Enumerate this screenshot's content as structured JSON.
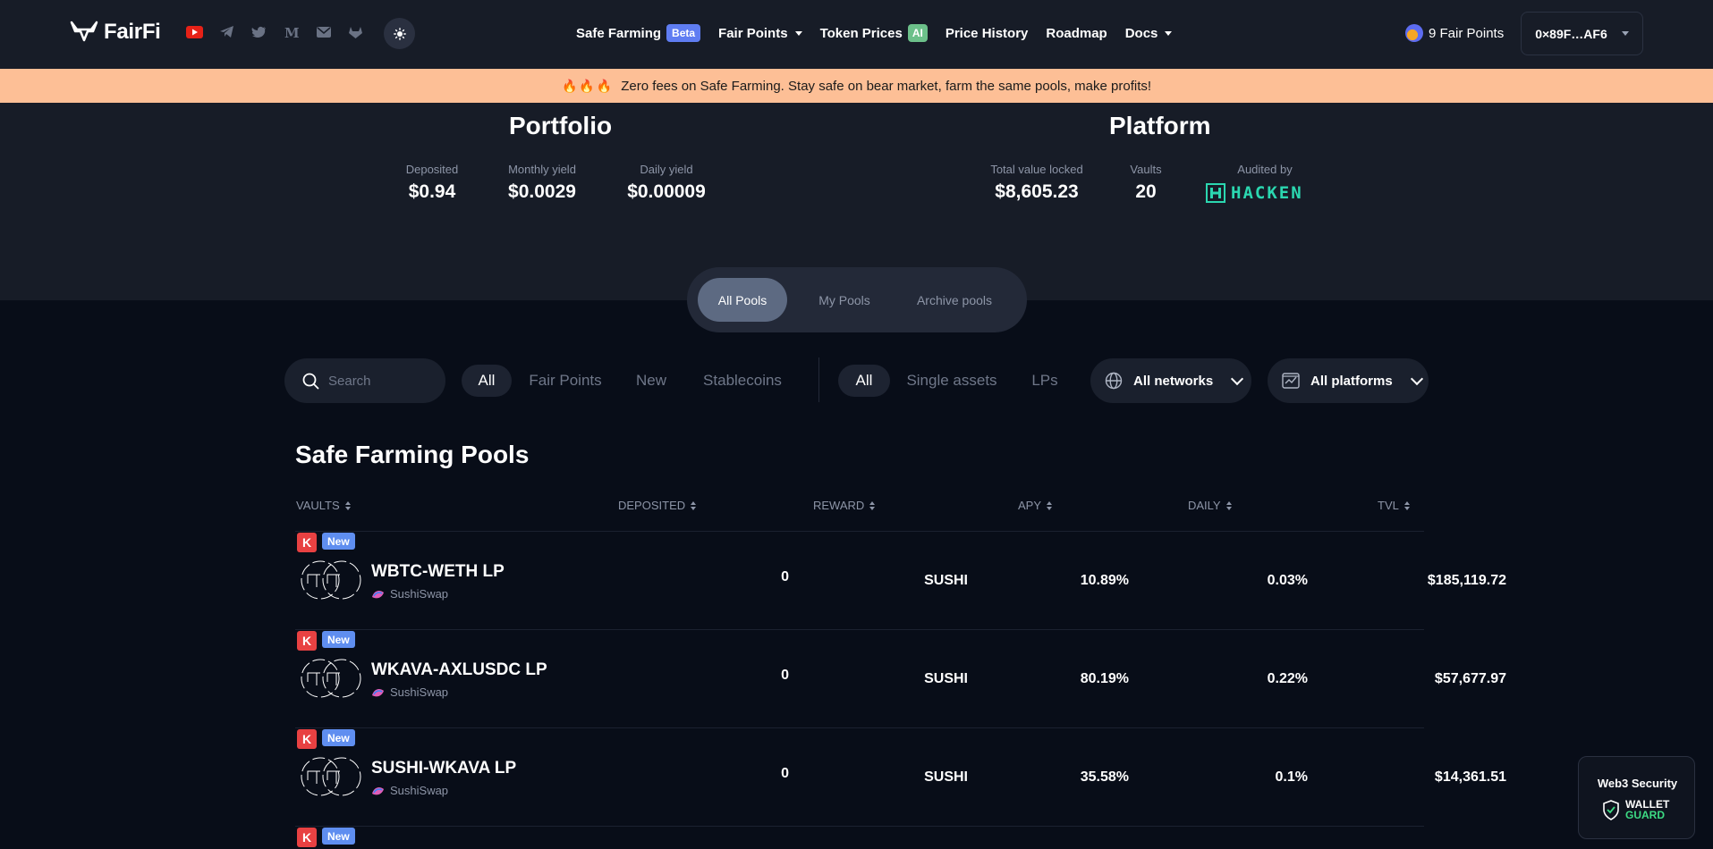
{
  "header": {
    "logo_text": "FairFi",
    "socials": [
      "youtube-icon",
      "telegram-icon",
      "twitter-icon",
      "medium-icon",
      "mail-icon",
      "gitlab-icon"
    ],
    "theme_icon": "sun-icon",
    "nav": {
      "safe_farming": "Safe Farming",
      "beta_badge": "Beta",
      "fair_points": "Fair Points",
      "token_prices": "Token Prices",
      "ai_badge": "AI",
      "price_history": "Price History",
      "roadmap": "Roadmap",
      "docs": "Docs"
    },
    "fair_points_label": "9 Fair Points",
    "wallet_address": "0×89F…AF6"
  },
  "banner": {
    "flames": "🔥🔥🔥",
    "text": "Zero fees on Safe Farming. Stay safe on bear market, farm the same pools, make profits!"
  },
  "portfolio": {
    "title": "Portfolio",
    "deposited_label": "Deposited",
    "deposited_value": "$0.94",
    "monthly_label": "Monthly yield",
    "monthly_value": "$0.0029",
    "daily_label": "Daily yield",
    "daily_value": "$0.00009"
  },
  "platform": {
    "title": "Platform",
    "tvl_label": "Total value locked",
    "tvl_value": "$8,605.23",
    "vaults_label": "Vaults",
    "vaults_value": "20",
    "audited_label": "Audited by",
    "auditor": "HACKEN"
  },
  "tabs": {
    "all_pools": "All Pools",
    "my_pools": "My Pools",
    "archive_pools": "Archive pools",
    "active": "All Pools"
  },
  "filters": {
    "search_placeholder": "Search",
    "category": [
      "All",
      "Fair Points",
      "New",
      "Stablecoins"
    ],
    "asset_type": [
      "All",
      "Single assets",
      "LPs"
    ],
    "networks": "All networks",
    "platforms": "All platforms"
  },
  "table": {
    "title": "Safe Farming Pools",
    "headers": {
      "vaults": "VAULTS",
      "deposited": "DEPOSITED",
      "reward": "REWARD",
      "apy": "APY",
      "daily": "DAILY",
      "tvl": "TVL"
    },
    "rows": [
      {
        "k_badge": "K",
        "new_badge": "New",
        "name": "WBTC-WETH LP",
        "platform": "SushiSwap",
        "deposited": "0",
        "reward": "SUSHI",
        "apy": "10.89%",
        "daily": "0.03%",
        "tvl": "$185,119.72"
      },
      {
        "k_badge": "K",
        "new_badge": "New",
        "name": "WKAVA-AXLUSDC LP",
        "platform": "SushiSwap",
        "deposited": "0",
        "reward": "SUSHI",
        "apy": "80.19%",
        "daily": "0.22%",
        "tvl": "$57,677.97"
      },
      {
        "k_badge": "K",
        "new_badge": "New",
        "name": "SUSHI-WKAVA LP",
        "platform": "SushiSwap",
        "deposited": "0",
        "reward": "SUSHI",
        "apy": "35.58%",
        "daily": "0.1%",
        "tvl": "$14,361.51"
      },
      {
        "k_badge": "K",
        "new_badge": "New"
      }
    ]
  },
  "wallet_guard": {
    "title": "Web3 Security",
    "line1": "WALLET",
    "line2": "GUARD"
  },
  "colors": {
    "background": "#080d18",
    "panel": "#171c27",
    "banner": "#fdbf96",
    "accent_blue": "#5f7df2",
    "hacken_green": "#2bd7b0",
    "kava_red": "#e84142"
  }
}
